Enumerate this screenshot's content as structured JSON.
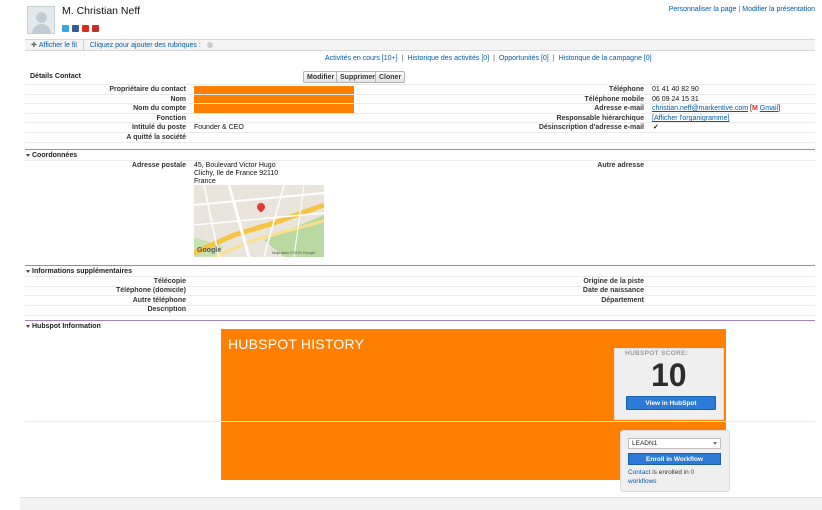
{
  "header": {
    "title": "M. Christian Neff",
    "top_links": [
      "Personnaliser la page",
      "Modifier la présentation"
    ]
  },
  "feed": {
    "show_feed": "Afficher le fil",
    "hint": "Cliquez pour ajouter des rubriques :"
  },
  "related_links": [
    "Activités en cours [10+]",
    "Historique des activités [0]",
    "Opportunités [0]",
    "Historique de la campagne [0]"
  ],
  "detail": {
    "section": "Détails Contact",
    "buttons": {
      "edit": "Modifier",
      "delete": "Supprimer",
      "clone": "Cloner"
    },
    "left": [
      {
        "label": "Propriétaire du contact",
        "value": ""
      },
      {
        "label": "Nom",
        "value": ""
      },
      {
        "label": "Nom du compte",
        "value": ""
      },
      {
        "label": "Fonction",
        "value": ""
      },
      {
        "label": "Intitulé du poste",
        "value": "Founder & CEO"
      },
      {
        "label": "A quitté la société",
        "value": ""
      }
    ],
    "right": [
      {
        "label": "Téléphone",
        "value": "01 41 40 82 90"
      },
      {
        "label": "Téléphone mobile",
        "value": "06 09 24 15 31"
      },
      {
        "label": "Adresse e-mail",
        "value": "christian.neff@markentive.com"
      },
      {
        "label": "Responsable hiérarchique",
        "value": "[Afficher l'organigramme]"
      },
      {
        "label": "Désinscription d'adresse e-mail",
        "value": "✓"
      }
    ],
    "gmail": "Gmail"
  },
  "coords": {
    "section": "Coordonnées",
    "postal_label": "Adresse postale",
    "postal_lines": [
      "45, Boulevard Victor Hugo",
      "Clichy, Ile de France 92110",
      "France"
    ],
    "other_label": "Autre adresse",
    "map_credit": "Map data ©2015 Google",
    "map_logo": "Google"
  },
  "extra": {
    "section": "Informations supplémentaires",
    "left": [
      "Télécopie",
      "Téléphone (domicile)",
      "Autre téléphone",
      "Description"
    ],
    "right": [
      "Origine de la piste",
      "Date de naissance",
      "Département"
    ]
  },
  "hubspot": {
    "section": "Hubspot Information",
    "history_title": "HUBSPOT HISTORY",
    "score_label": "HUBSPOT SCORE:",
    "score": "10",
    "view_button": "View in HubSpot",
    "workflow_select": "LEADN1",
    "enroll_button": "Enroll in Workflow",
    "contact_link": "Contact",
    "enrolled_text": " is enrolled in ",
    "count_link": "0",
    "workflows_link": "workflows"
  },
  "colors": {
    "redaction": "#ff7f00",
    "link": "#015ba7",
    "section_rule": "#a285b8",
    "button_blue": "#2b7bd7"
  }
}
